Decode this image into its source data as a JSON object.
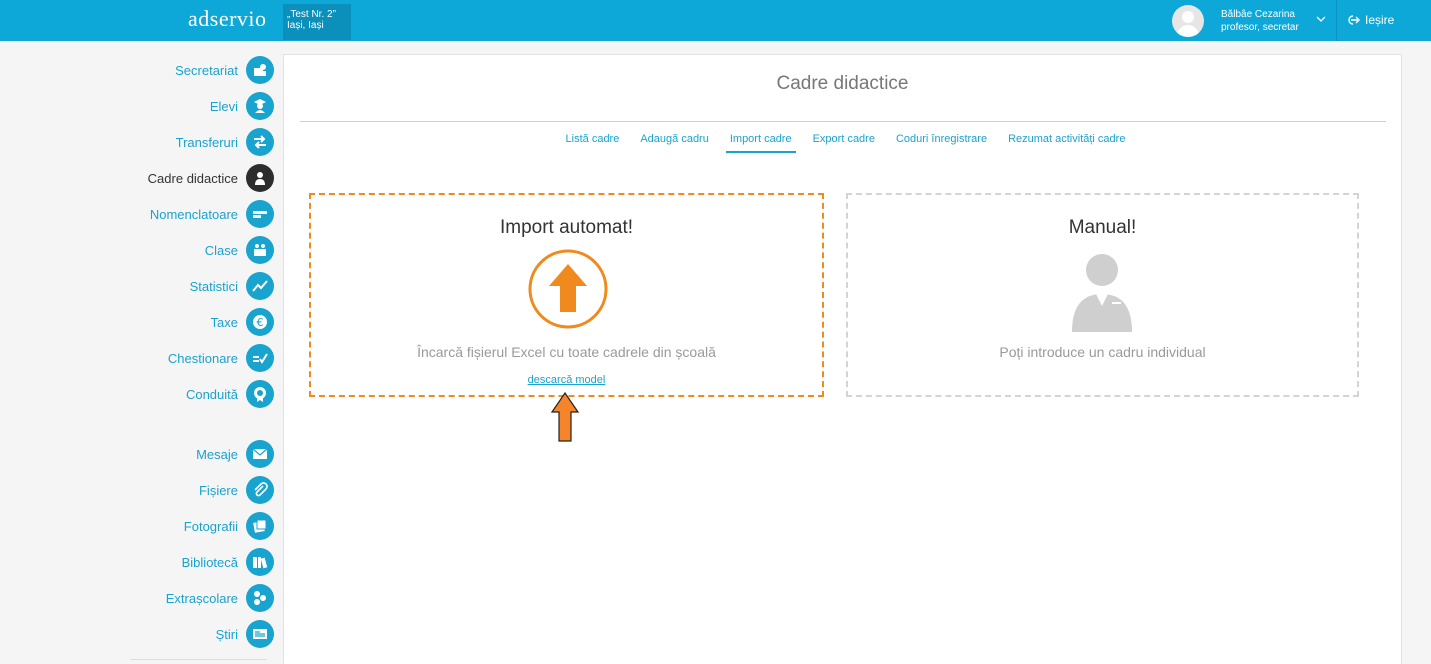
{
  "header": {
    "logo": "adservio",
    "school_name": "„Test Nr. 2”",
    "school_city": "Iași, Iași",
    "user_name": "Bălbâe Cezarina",
    "user_role": "profesor, secretar",
    "logout_label": "Ieșire"
  },
  "sidebar": {
    "items": [
      {
        "label": "Secretariat",
        "icon": "secretariat-icon"
      },
      {
        "label": "Elevi",
        "icon": "student-icon"
      },
      {
        "label": "Transferuri",
        "icon": "transfer-icon"
      },
      {
        "label": "Cadre didactice",
        "icon": "teacher-icon",
        "active": true
      },
      {
        "label": "Nomenclatoare",
        "icon": "nomenclature-icon"
      },
      {
        "label": "Clase",
        "icon": "classes-icon"
      },
      {
        "label": "Statistici",
        "icon": "chart-icon"
      },
      {
        "label": "Taxe",
        "icon": "euro-icon"
      },
      {
        "label": "Chestionare",
        "icon": "survey-icon"
      },
      {
        "label": "Conduită",
        "icon": "conduct-icon"
      },
      {
        "label": "Mesaje",
        "icon": "mail-icon"
      },
      {
        "label": "Fișiere",
        "icon": "paperclip-icon"
      },
      {
        "label": "Fotografii",
        "icon": "photos-icon"
      },
      {
        "label": "Bibliotecă",
        "icon": "library-icon"
      },
      {
        "label": "Extrașcolare",
        "icon": "extracurricular-icon"
      },
      {
        "label": "Știri",
        "icon": "news-icon"
      }
    ]
  },
  "main": {
    "title": "Cadre didactice",
    "tabs": [
      {
        "label": "Listă cadre"
      },
      {
        "label": "Adaugă cadru"
      },
      {
        "label": "Import cadre",
        "active": true
      },
      {
        "label": "Export cadre"
      },
      {
        "label": "Coduri înregistrare"
      },
      {
        "label": "Rezumat activități cadre"
      }
    ],
    "auto_card": {
      "heading": "Import automat!",
      "description": "Încarcă fișierul Excel cu toate cadrele din școală",
      "link": "descarcă model"
    },
    "manual_card": {
      "heading": "Manual!",
      "description": "Poți introduce un cadru individual"
    }
  },
  "colors": {
    "brand": "#0ea8d8",
    "accent": "#19a3cf",
    "orange": "#f08a1e"
  }
}
